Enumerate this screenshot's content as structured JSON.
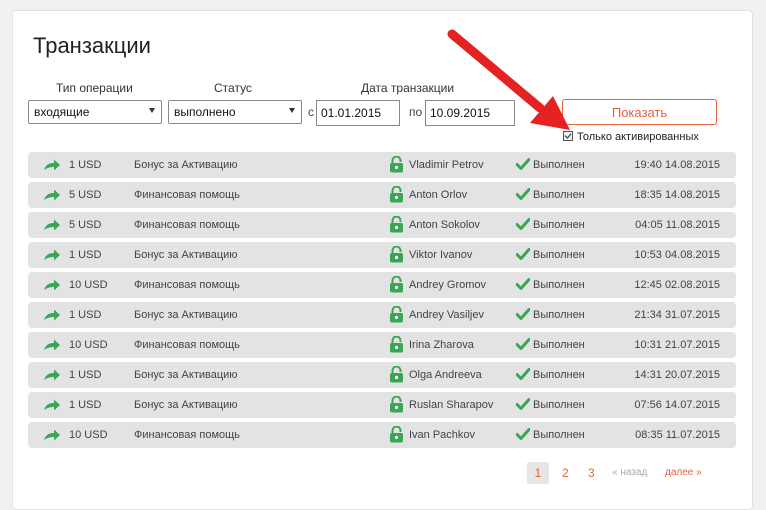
{
  "page": {
    "title": "Транзакции"
  },
  "filters": {
    "operation_type_label": "Тип операции",
    "operation_type_value": "входящие",
    "status_label": "Статус",
    "status_value": "выполнено",
    "date_label": "Дата транзакции",
    "from_prefix": "с",
    "from_date": "01.01.2015",
    "to_prefix": "по",
    "to_date": "10.09.2015",
    "show_button": "Показать",
    "only_activated_label": "Только активированных",
    "only_activated_checked": true
  },
  "transactions": [
    {
      "amount": "1 USD",
      "description": "Бонус за Активацию",
      "user": "Vladimir Petrov",
      "status": "Выполнен",
      "datetime": "19:40 14.08.2015"
    },
    {
      "amount": "5 USD",
      "description": "Финансовая помощь",
      "user": "Anton Orlov",
      "status": "Выполнен",
      "datetime": "18:35 14.08.2015"
    },
    {
      "amount": "5 USD",
      "description": "Финансовая помощь",
      "user": "Anton Sokolov",
      "status": "Выполнен",
      "datetime": "04:05 11.08.2015"
    },
    {
      "amount": "1 USD",
      "description": "Бонус за Активацию",
      "user": "Viktor Ivanov",
      "status": "Выполнен",
      "datetime": "10:53 04.08.2015"
    },
    {
      "amount": "10 USD",
      "description": "Финансовая помощь",
      "user": "Andrey Gromov",
      "status": "Выполнен",
      "datetime": "12:45 02.08.2015"
    },
    {
      "amount": "1 USD",
      "description": "Бонус за Активацию",
      "user": "Andrey Vasiljev",
      "status": "Выполнен",
      "datetime": "21:34 31.07.2015"
    },
    {
      "amount": "10 USD",
      "description": "Финансовая помощь",
      "user": "Irina Zharova",
      "status": "Выполнен",
      "datetime": "10:31 21.07.2015"
    },
    {
      "amount": "1 USD",
      "description": "Бонус за Активацию",
      "user": "Olga Andreeva",
      "status": "Выполнен",
      "datetime": "14:31 20.07.2015"
    },
    {
      "amount": "1 USD",
      "description": "Бонус за Активацию",
      "user": "Ruslan Sharapov",
      "status": "Выполнен",
      "datetime": "07:56 14.07.2015"
    },
    {
      "amount": "10 USD",
      "description": "Финансовая помощь",
      "user": "Ivan Pachkov",
      "status": "Выполнен",
      "datetime": "08:35 11.07.2015"
    }
  ],
  "pagination": {
    "pages": [
      "1",
      "2",
      "3"
    ],
    "current": "1",
    "prev_label": "« назад",
    "next_label": "далее »"
  },
  "colors": {
    "accent": "#e8603a",
    "row_bg": "#e3e3e3",
    "incoming_arrow": "#3aa655",
    "lock_icon": "#3aa655",
    "check_icon": "#3aa655",
    "annotation_arrow": "#e52222"
  },
  "icons": {
    "row_type": "incoming-arrow-icon",
    "user": "unlocked-padlock-icon",
    "status": "checkmark-icon",
    "annotation": "red-pointer-arrow"
  }
}
